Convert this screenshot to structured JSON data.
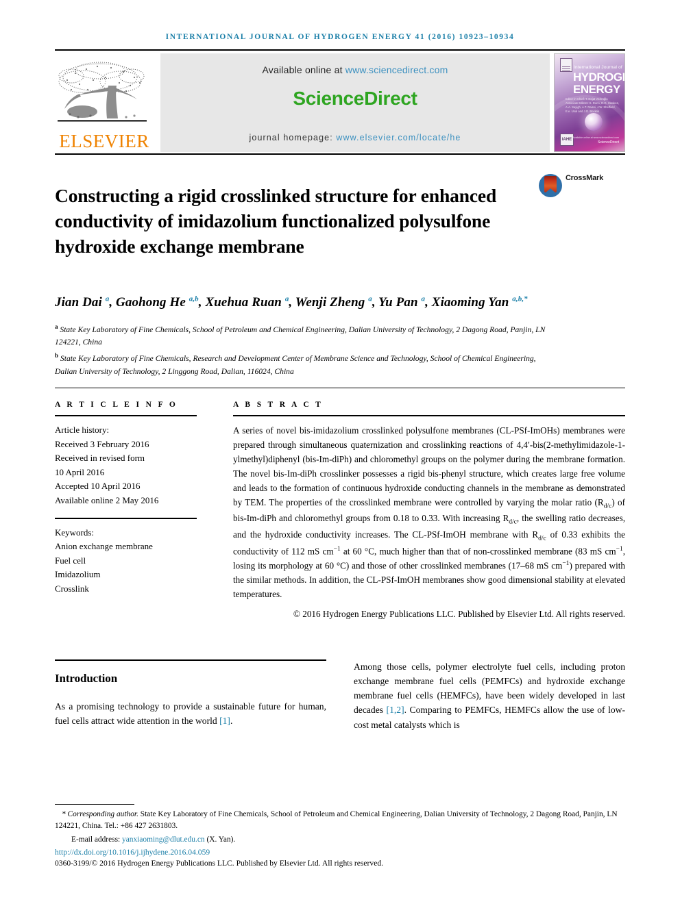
{
  "running_head": "INTERNATIONAL JOURNAL OF HYDROGEN ENERGY 41 (2016) 10923–10934",
  "masthead": {
    "publisher_name": "ELSEVIER",
    "available_prefix": "Available online at ",
    "available_url": "www.sciencedirect.com",
    "sciencedirect_logo": "ScienceDirect",
    "homepage_prefix": "journal homepage: ",
    "homepage_url": "www.elsevier.com/locate/he",
    "cover": {
      "subtitle": "International Journal of",
      "title_line1": "HYDROGEN",
      "title_line2": "ENERGY",
      "editors": "Editor-in-Chief: T. Nejat Veziroğlu   Associate Editors: S. Dunn, D.G. Hawkes, A.A. Sayigh, A.T. Raissi, J.W. Sheffield, E.e. Unal and J.O. Bockris",
      "iahe_mark": "IAHE",
      "sciencedirect_mark": "ScienceDirect",
      "available_mark": "Available online at www.sciencedirect.com"
    }
  },
  "article": {
    "title": "Constructing a rigid crosslinked structure for enhanced conductivity of imidazolium functionalized polysulfone hydroxide exchange membrane",
    "crossmark_label": "CrossMark",
    "authors_html": "Jian Dai <sup>a</sup>, Gaohong He <sup>a,b</sup>, Xuehua Ruan <sup>a</sup>, Wenji Zheng <sup>a</sup>, Yu Pan <sup>a</sup>, Xiaoming Yan <sup>a,b,*</sup>",
    "affiliation_a": "State Key Laboratory of Fine Chemicals, School of Petroleum and Chemical Engineering, Dalian University of Technology, 2 Dagong Road, Panjin, LN 124221, China",
    "affiliation_b": "State Key Laboratory of Fine Chemicals, Research and Development Center of Membrane Science and Technology, School of Chemical Engineering, Dalian University of Technology, 2 Linggong Road, Dalian, 116024, China",
    "affiliation_a_marker": "a",
    "affiliation_b_marker": "b"
  },
  "article_info": {
    "heading": "A R T I C L E   I N F O",
    "history_label": "Article history:",
    "history": [
      "Received 3 February 2016",
      "Received in revised form",
      "10 April 2016",
      "Accepted 10 April 2016",
      "Available online 2 May 2016"
    ],
    "keywords_label": "Keywords:",
    "keywords": [
      "Anion exchange membrane",
      "Fuel cell",
      "Imidazolium",
      "Crosslink"
    ]
  },
  "abstract": {
    "heading": "A B S T R A C T",
    "body_html": "A series of novel bis-imidazolium crosslinked polysulfone membranes (CL-PSf-ImOHs) membranes were prepared through simultaneous quaternization and crosslinking reactions of 4,4&#8242;-bis(2-methylimidazole-1-ylmethyl)diphenyl (bis-Im-diPh) and chloromethyl groups on the polymer during the membrane formation. The novel bis-Im-diPh crosslinker possesses a rigid bis-phenyl structure, which creates large free volume and leads to the formation of continuous hydroxide conducting channels in the membrane as demonstrated by TEM. The properties of the crosslinked membrane were controlled by varying the molar ratio (R<sub>d/c</sub>) of bis-Im-diPh and chloromethyl groups from 0.18 to 0.33. With increasing R<sub>d/c</sub>, the swelling ratio decreases, and the hydroxide conductivity increases. The CL-PSf-ImOH membrane with R<sub>d/c</sub> of 0.33 exhibits the conductivity of 112 mS cm<sup class=\"num\">&#8722;1</sup> at 60 &#176;C, much higher than that of non-crosslinked membrane (83 mS cm<sup class=\"num\">&#8722;1</sup>, losing its morphology at 60 &#176;C) and those of other crosslinked membranes (17&#8211;68 mS cm<sup class=\"num\">&#8722;1</sup>) prepared with the similar methods. In addition, the CL-PSf-ImOH membranes show good dimensional stability at elevated temperatures.",
    "copyright": "© 2016 Hydrogen Energy Publications LLC. Published by Elsevier Ltd. All rights reserved."
  },
  "introduction": {
    "heading": "Introduction",
    "left_html": "As a promising technology to provide a sustainable future for human, fuel cells attract wide attention in the world <span class=\"ref\">[1]</span>.",
    "right_html": "Among those cells, polymer electrolyte fuel cells, including proton exchange membrane fuel cells (PEMFCs) and hydroxide exchange membrane fuel cells (HEMFCs), have been widely developed in last decades <span class=\"ref\">[1,2]</span>. Comparing to PEMFCs, HEMFCs allow the use of low-cost metal catalysts which is"
  },
  "footer": {
    "corresponding_html": "<span class=\"lead\">* Corresponding author.</span> State Key Laboratory of Fine Chemicals, School of Petroleum and Chemical Engineering, Dalian University of Technology, 2 Dagong Road, Panjin, LN 124221, China. Tel.: +86 427 2631803.",
    "email_label": "E-mail address: ",
    "email": "yanxiaoming@dlut.edu.cn",
    "email_suffix": " (X. Yan).",
    "doi": "http://dx.doi.org/10.1016/j.ijhydene.2016.04.059",
    "issn_line": "0360-3199/© 2016 Hydrogen Energy Publications LLC. Published by Elsevier Ltd. All rights reserved."
  },
  "colors": {
    "link_blue": "#1b7fa8",
    "sciencedirect_green": "#2ea521",
    "elsevier_orange": "#ef8200",
    "banner_gray": "#e7e7e7",
    "crossmark_blue": "#2f6fa8",
    "crossmark_red": "#c9361c"
  }
}
